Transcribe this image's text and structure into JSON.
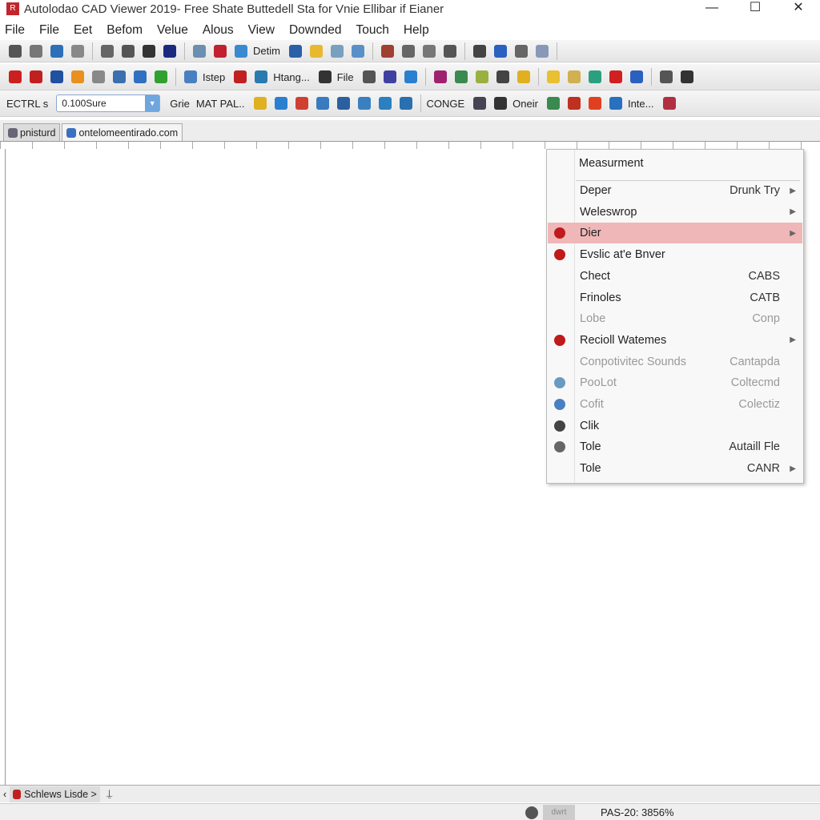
{
  "window": {
    "title": "Autolodao CAD Viewer 2019- Free Shate Buttedell Sta for Vnie Ellibar if Eianer",
    "app_icon": "R",
    "controls": [
      "—",
      "☐",
      "✕"
    ]
  },
  "menubar": [
    "File",
    "File",
    "Eet",
    "Befom",
    "Velue",
    "Alous",
    "View",
    "Downded",
    "Touch",
    "Help"
  ],
  "toolbar1": {
    "icons": [
      "#555",
      "#777",
      "#2d6fb8",
      "#888",
      "#666",
      "#555",
      "#333",
      "#1a2a80",
      "#6a8fb0",
      "#c02030",
      "#3a8ad0"
    ],
    "label_detim": "Detim",
    "icons2": [
      "#2a60a8",
      "#e8b830",
      "#7aa0c0",
      "#5a90c8",
      "#a04030",
      "#666",
      "#777",
      "#555",
      "#444",
      "#2a60c0",
      "#666",
      "#8898b8"
    ]
  },
  "toolbar2": {
    "labels": {
      "istep": "Istep",
      "htang": "Htang...",
      "file": "File"
    },
    "icons": [
      "#cc2020",
      "#c02020",
      "#2050a0",
      "#e89020",
      "#888",
      "#3a6fb0",
      "#3070c0",
      "#30a030",
      "#4a80c0",
      "#c02020",
      "#2a7ab0",
      "#333",
      "#555",
      "#4040a0",
      "#2a80d0",
      "#a02070",
      "#3a8a50",
      "#9ab040",
      "#444",
      "#e0b020",
      "#e8c030",
      "#d0b050",
      "#2aa080",
      "#d02020",
      "#2a60c0",
      "#555",
      "#333"
    ]
  },
  "toolbar3": {
    "label_ctrl": "ECTRL s",
    "combo_value": "0.100Sure",
    "label_grid": "Grie",
    "label_mat": "MAT PAL..",
    "label_conge": "CONGE",
    "label_oneir": "Oneir",
    "label_inte": "Inte...",
    "icons": [
      "#e0b020",
      "#2a80d0",
      "#d04030",
      "#3a7ac0",
      "#2a60a0",
      "#3a80c0",
      "#2a80c0",
      "#2a70b0",
      "#445",
      "#333",
      "#3a8a50",
      "#c03020",
      "#e04020",
      "#2a70c0",
      "#206070",
      "#b03040"
    ]
  },
  "tabs": [
    {
      "label": "pnisturd"
    },
    {
      "label": "ontelomeentirado.com"
    }
  ],
  "context_menu": {
    "header": "Measurment",
    "items": [
      {
        "label": "Deper",
        "shortcut": "Drunk Try",
        "submenu": true,
        "disabled": false
      },
      {
        "label": "Weleswrop",
        "shortcut": "",
        "submenu": true,
        "disabled": false
      },
      {
        "label": "Dier",
        "shortcut": "",
        "submenu": true,
        "highlighted": true,
        "icon": "#c01a1a"
      },
      {
        "label": "Evslic at'e Bnver",
        "shortcut": "",
        "icon": "#c01a1a"
      },
      {
        "label": "Chect",
        "shortcut": "CABS"
      },
      {
        "label": "Frinoles",
        "shortcut": "CATB"
      },
      {
        "label": "Lobe",
        "shortcut": "Conp",
        "disabled": true
      },
      {
        "label": "Recioll Watemes",
        "shortcut": "",
        "submenu": true,
        "icon": "#c01a1a"
      },
      {
        "label": "Conpotivitec Sounds",
        "shortcut": "Cantapda",
        "disabled": true
      },
      {
        "label": "PooLot",
        "shortcut": "Coltecmd",
        "disabled": true,
        "icon": "#6a9ac0"
      },
      {
        "label": "Cofit",
        "shortcut": "Colectiz",
        "disabled": true,
        "icon": "#4a80c0"
      },
      {
        "label": "Clik",
        "shortcut": "",
        "icon": "#444"
      },
      {
        "label": "Tole",
        "shortcut": "Autaill Fle",
        "icon": "#666"
      },
      {
        "label": "Tole",
        "shortcut": "CANR",
        "submenu": true
      }
    ]
  },
  "bottom_tab": {
    "label": "Schlews Lisde >"
  },
  "status": {
    "mini_label": "dwrt",
    "zoom": "PAS-20: 3856%"
  }
}
